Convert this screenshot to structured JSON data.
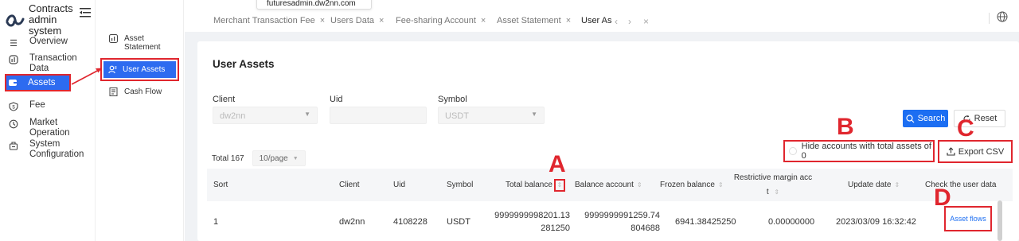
{
  "app": {
    "title": "Contracts admin system"
  },
  "tooltip": {
    "text": "futuresadmin.dw2nn.com"
  },
  "sidebar": {
    "items": [
      {
        "label": "Overview",
        "icon": "menu-icon"
      },
      {
        "label": "Transaction Data",
        "icon": "transaction-icon"
      },
      {
        "label": "Assets",
        "icon": "assets-icon"
      },
      {
        "label": "Fee",
        "icon": "fee-icon"
      },
      {
        "label": "Market Operation",
        "icon": "market-icon"
      },
      {
        "label": "System Configuration",
        "icon": "config-icon"
      }
    ]
  },
  "submenu": {
    "items": [
      {
        "label": "Asset Statement",
        "icon": "statement-icon"
      },
      {
        "label": "User Assets",
        "icon": "user-icon"
      },
      {
        "label": "Cash Flow",
        "icon": "cashflow-icon"
      }
    ]
  },
  "tabs": [
    {
      "label": "Merchant Transaction Fee"
    },
    {
      "label": "Users Data"
    },
    {
      "label": "Fee-sharing Account"
    },
    {
      "label": "Asset Statement"
    },
    {
      "label": "User As"
    }
  ],
  "page": {
    "title": "User Assets"
  },
  "filters": {
    "client_label": "Client",
    "client_value": "dw2nn",
    "uid_label": "Uid",
    "uid_value": "",
    "symbol_label": "Symbol",
    "symbol_value": "USDT",
    "search_label": "Search",
    "reset_label": "Reset"
  },
  "toolbar": {
    "total": "Total 167",
    "page_size": "10/page",
    "hide_label": "Hide accounts with total assets of 0",
    "export_label": "Export CSV"
  },
  "markers": {
    "a": "A",
    "b": "B",
    "c": "C",
    "d": "D"
  },
  "table": {
    "headers": {
      "sort": "Sort",
      "client": "Client",
      "uid": "Uid",
      "symbol": "Symbol",
      "total_balance": "Total balance",
      "balance_account": "Balance account",
      "frozen_balance": "Frozen balance",
      "restrictive_1": "Restrictive margin acc",
      "restrictive_2": "t",
      "update_date": "Update date",
      "check": "Check the user data"
    },
    "rows": [
      {
        "sort": "1",
        "client": "dw2nn",
        "uid": "4108228",
        "symbol": "USDT",
        "total_balance_1": "9999999998201.13",
        "total_balance_2": "281250",
        "balance_account_1": "9999999991259.74",
        "balance_account_2": "804688",
        "frozen_balance": "6941.38425250",
        "restrictive_margin": "0.00000000",
        "update_date": "2023/03/09 16:32:42",
        "action": "Asset flows"
      }
    ]
  },
  "colors": {
    "accent": "#1c6ef2",
    "highlight": "#e0262e"
  }
}
